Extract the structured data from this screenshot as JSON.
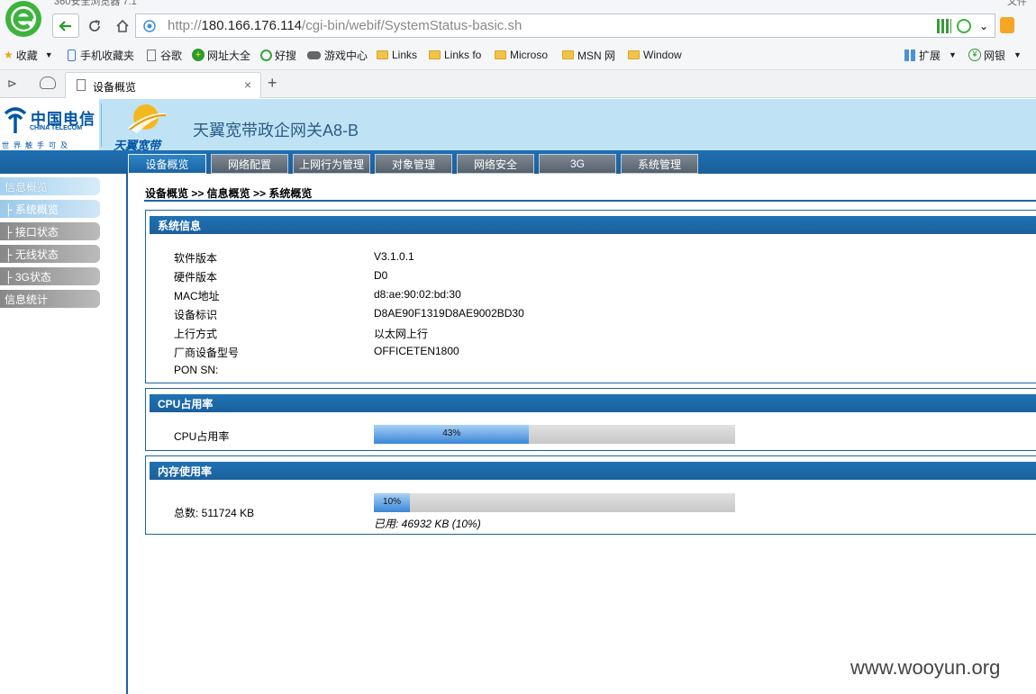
{
  "browser": {
    "titlebar_text": "360安全浏览器 7.1",
    "titlebar_right": "文件",
    "url_prefix": "http://",
    "url_host": "180.166.176.114",
    "url_path": "/cgi-bin/webif/SystemStatus-basic.sh",
    "bookmarks": [
      "收藏",
      "手机收藏夹",
      "谷歌",
      "网址大全",
      "好搜",
      "游戏中心",
      "Links",
      "Links fo",
      "Microso",
      "MSN 网",
      "Window"
    ],
    "bookmarks_right": [
      "扩展",
      "网银"
    ],
    "tab_title": "设备概览"
  },
  "header": {
    "ct_name": "中国电信",
    "ct_en": "CHINA TELECOM",
    "ct_slogan": "世界触手可及",
    "ty_text": "天翼宽带",
    "device_title": "天翼宽带政企网关A8-B"
  },
  "nav": [
    "设备概览",
    "网络配置",
    "上网行为管理",
    "对象管理",
    "网络安全",
    "3G",
    "系统管理"
  ],
  "sidebar": [
    {
      "label": "信息概览"
    },
    {
      "label": "├ 系统概览"
    },
    {
      "label": "├ 接口状态"
    },
    {
      "label": "├ 无线状态"
    },
    {
      "label": "├ 3G状态"
    },
    {
      "label": "信息统计"
    }
  ],
  "breadcrumb": "设备概览 >> 信息概览 >> 系统概览",
  "system_info": {
    "title": "系统信息",
    "rows": [
      {
        "label": "软件版本",
        "value": "V3.1.0.1"
      },
      {
        "label": "硬件版本",
        "value": "D0"
      },
      {
        "label": "MAC地址",
        "value": "d8:ae:90:02:bd:30"
      },
      {
        "label": "设备标识",
        "value": "D8AE90F1319D8AE9002BD30"
      },
      {
        "label": "上行方式",
        "value": "以太网上行"
      },
      {
        "label": "厂商设备型号",
        "value": "OFFICETEN1800"
      },
      {
        "label": "PON SN:",
        "value": ""
      }
    ]
  },
  "cpu": {
    "title": "CPU占用率",
    "label": "CPU占用率",
    "percent": 43,
    "percent_text": "43%"
  },
  "memory": {
    "title": "内存使用率",
    "total_text": "总数: 511724 KB",
    "percent": 10,
    "percent_text": "10%",
    "used_text": "已用: 46932 KB (10%)"
  },
  "watermark": "www.wooyun.org",
  "colors": {
    "nav_blue": "#1c64a4",
    "header_bg": "#bfe3f5",
    "bar_fill": "#3a86d8"
  }
}
